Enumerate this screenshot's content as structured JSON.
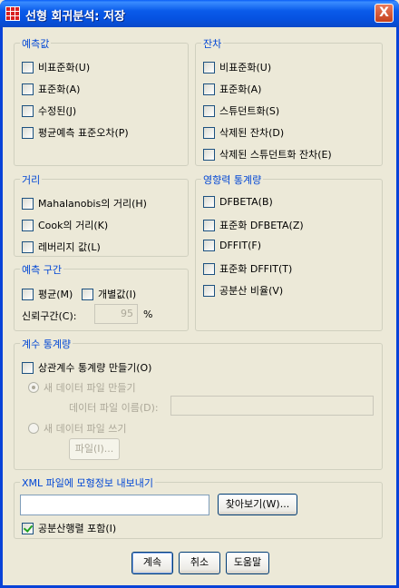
{
  "window": {
    "title": "선형 회귀분석: 저장",
    "close_label": "X"
  },
  "predicted": {
    "title": "예측값",
    "items": [
      "비표준화(U)",
      "표준화(A)",
      "수정된(J)",
      "평균예측 표준오차(P)"
    ]
  },
  "residuals": {
    "title": "잔차",
    "items": [
      "비표준화(U)",
      "표준화(A)",
      "스튜던트화(S)",
      "삭제된 잔차(D)",
      "삭제된 스튜던트화 잔차(E)"
    ]
  },
  "distances": {
    "title": "거리",
    "items": [
      "Mahalanobis의 거리(H)",
      "Cook의 거리(K)",
      "레버리지 값(L)"
    ]
  },
  "influence": {
    "title": "영향력 통계량",
    "items": [
      "DFBETA(B)",
      "표준화 DFBETA(Z)",
      "DFFIT(F)",
      "표준화 DFFIT(T)",
      "공분산 비율(V)"
    ]
  },
  "prediction_interval": {
    "title": "예측 구간",
    "mean_label": "평균(M)",
    "individual_label": "개별값(I)",
    "ci_label": "신뢰구간(C):",
    "ci_value": "95",
    "ci_unit": "%"
  },
  "coef_stats": {
    "title": "계수 통계량",
    "create_label": "상관계수 통계량 만들기(O)",
    "new_dataset_label": "새 데이터 파일 만들기",
    "dataset_name_label": "데이터 파일 이름(D):",
    "write_file_label": "새 데이터 파일 쓰기",
    "file_button": "파일(I)..."
  },
  "xml_export": {
    "title": "XML 파일에 모형정보 내보내기",
    "path_value": "",
    "browse_button": "찾아보기(W)...",
    "include_cov_label": "공분산행렬 포함(I)"
  },
  "buttons": {
    "continue": "계속",
    "cancel": "취소",
    "help": "도움말"
  }
}
